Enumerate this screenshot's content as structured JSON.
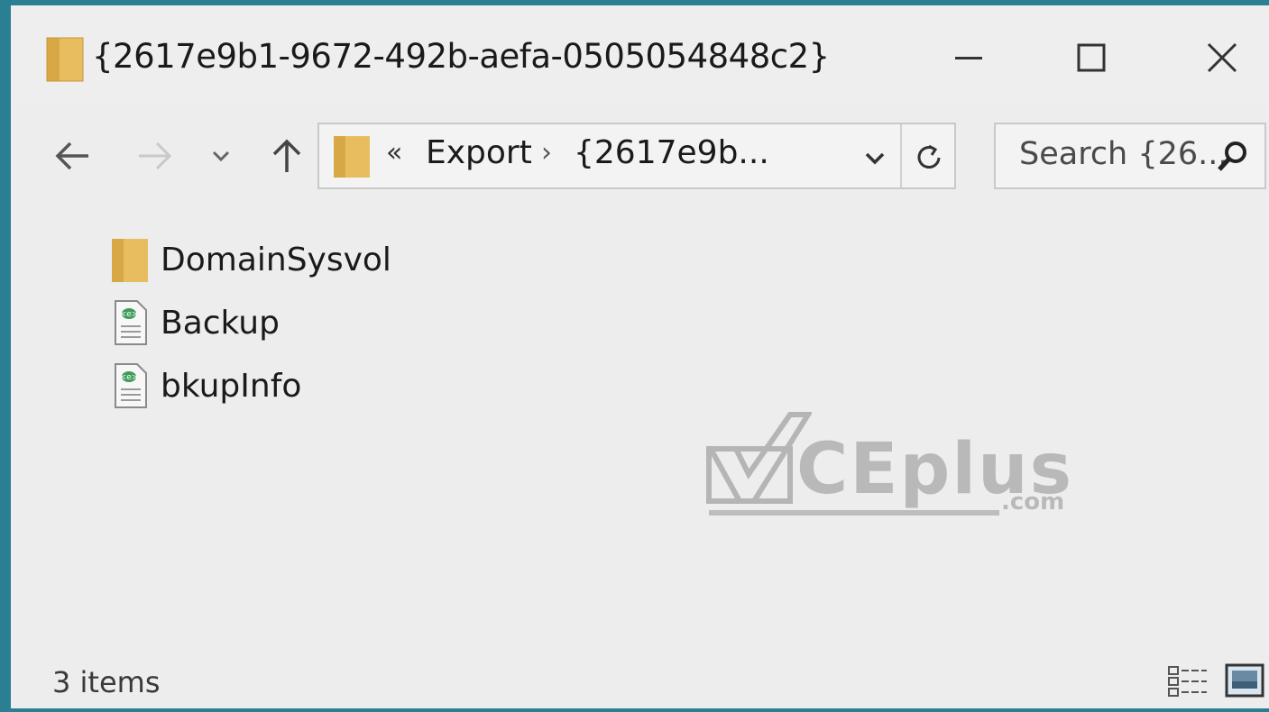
{
  "window": {
    "title": "{2617e9b1-9672-492b-aefa-0505054848c2}",
    "controls": {
      "minimize_icon": "minimize-icon",
      "maximize_icon": "maximize-icon",
      "close_icon": "close-icon"
    },
    "accent_color": "#2b7f93"
  },
  "navigation": {
    "back_icon": "arrow-left-icon",
    "forward_icon": "arrow-right-icon",
    "recent_icon": "chevron-down-icon",
    "up_icon": "arrow-up-icon"
  },
  "address_bar": {
    "overflow_glyph": "«",
    "breadcrumbs": [
      "Export",
      "{2617e9b..."
    ],
    "separator": "›"
  },
  "search": {
    "placeholder": "Search {26..."
  },
  "files": [
    {
      "name": "DomainSysvol",
      "icon": "folder-icon"
    },
    {
      "name": "Backup",
      "icon": "xml-file-icon"
    },
    {
      "name": "bkupInfo",
      "icon": "xml-file-icon"
    }
  ],
  "watermark": {
    "text": "CEplus",
    "suffix": ".com"
  },
  "status": {
    "item_count": "3 items"
  },
  "view_modes": {
    "details_icon": "details-view-icon",
    "large_icons_icon": "large-icons-view-icon"
  }
}
